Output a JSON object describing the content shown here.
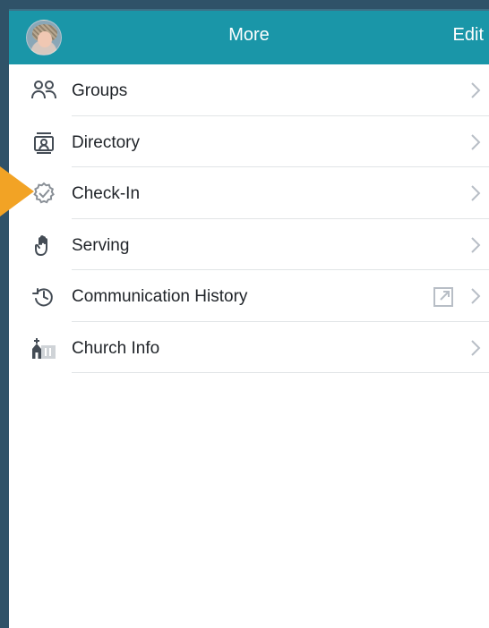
{
  "header": {
    "title": "More",
    "edit_label": "Edit"
  },
  "menu": [
    {
      "label": "Groups",
      "icon": "groups-icon"
    },
    {
      "label": "Directory",
      "icon": "directory-icon"
    },
    {
      "label": "Check-In",
      "icon": "check-in-icon"
    },
    {
      "label": "Serving",
      "icon": "serving-hand-icon"
    },
    {
      "label": "Communication History",
      "icon": "history-icon",
      "external": true
    },
    {
      "label": "Church Info",
      "icon": "church-icon"
    }
  ],
  "colors": {
    "header_bg": "#1a96a8",
    "callout": "#f2a325",
    "chevron": "#b8bec6",
    "outer_bg": "#2f5268"
  }
}
